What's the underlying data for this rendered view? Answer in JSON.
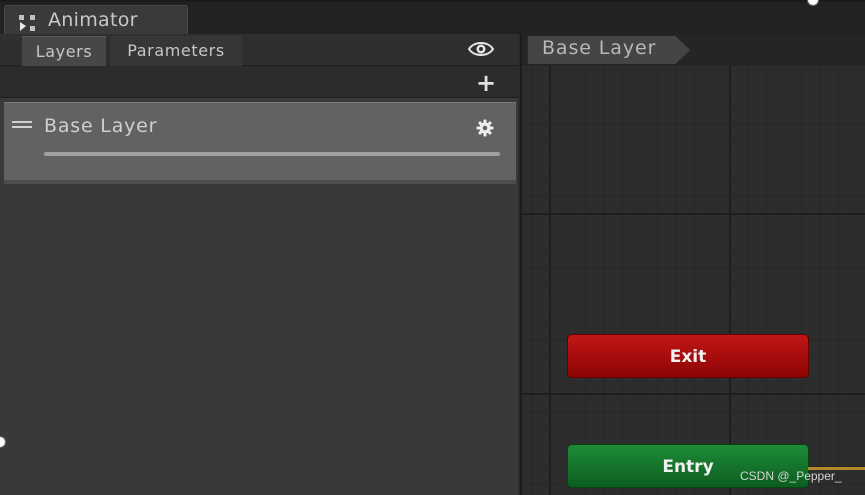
{
  "window": {
    "title": "Animator",
    "tab_icon": "animator-grid-icon"
  },
  "left_panel": {
    "tabs": [
      {
        "label": "Layers",
        "active": true
      },
      {
        "label": "Parameters",
        "active": false
      }
    ],
    "visibility_icon": "eye-icon",
    "add_icon": "plus-icon",
    "layers": [
      {
        "name": "Base Layer",
        "drag_icon": "drag-handle-icon",
        "settings_icon": "gear-icon",
        "weight": 1.0
      }
    ]
  },
  "graph": {
    "breadcrumb": "Base Layer",
    "nodes": {
      "exit": {
        "label": "Exit",
        "color": "#a80b0b"
      },
      "entry": {
        "label": "Entry",
        "color": "#177a2d"
      }
    },
    "transition_color": "#b5862a"
  },
  "watermark": "CSDN @_Pepper_"
}
